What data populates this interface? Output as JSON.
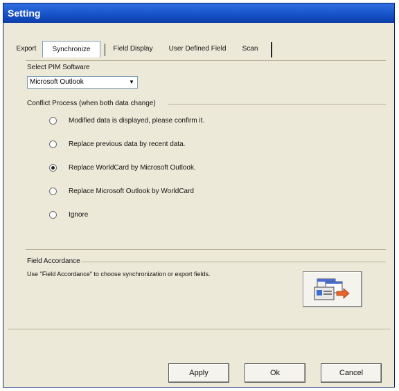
{
  "window": {
    "title": "Setting"
  },
  "tabs": [
    {
      "label": "Export"
    },
    {
      "label": "Synchronize"
    },
    {
      "label": "Field Display"
    },
    {
      "label": "User Defined Field"
    },
    {
      "label": "Scan"
    }
  ],
  "pim": {
    "label": "Select PIM Software",
    "selected": "Microsoft Outlook"
  },
  "conflict": {
    "title": "Conflict Process (when both data change)",
    "options": [
      {
        "label": "Modified data is displayed, please confirm it.",
        "checked": false
      },
      {
        "label": "Replace previous data by recent data.",
        "checked": false
      },
      {
        "label": "Replace WorldCard by Microsoft Outlook.",
        "checked": true
      },
      {
        "label": "Replace Microsoft Outlook by WorldCard",
        "checked": false
      },
      {
        "label": "Ignore",
        "checked": false
      }
    ]
  },
  "field_accordance": {
    "title": "Field Accordance",
    "description": "Use \"Field Accordance\" to choose synchronization or export fields."
  },
  "buttons": {
    "apply": "Apply",
    "ok": "Ok",
    "cancel": "Cancel"
  }
}
